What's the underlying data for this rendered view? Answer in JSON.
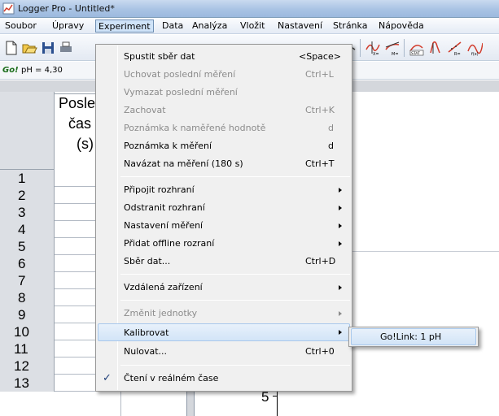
{
  "window": {
    "title": "Logger Pro - Untitled*"
  },
  "menubar": {
    "items": [
      "Soubor",
      "Úpravy",
      "Experiment",
      "Data",
      "Analýza",
      "Vložit",
      "Nastavení",
      "Stránka",
      "Nápověda"
    ],
    "active": "Experiment"
  },
  "sensor": {
    "badge": "Go!",
    "reading": "pH = 4,30"
  },
  "table": {
    "header_line1": "Posle",
    "header_line2": "čas",
    "header_line3": "(s)",
    "rows": [
      "1",
      "2",
      "3",
      "4",
      "5",
      "6",
      "7",
      "8",
      "9",
      "10",
      "11",
      "12",
      "13"
    ]
  },
  "graph": {
    "tick_label": "5"
  },
  "experiment_menu": {
    "items": [
      {
        "label": "Spustit sběr dat",
        "shortcut": "<Space>",
        "enabled": true
      },
      {
        "label": "Uchovat poslední měření",
        "shortcut": "Ctrl+L",
        "enabled": false
      },
      {
        "label": "Vymazat poslední měření",
        "shortcut": "",
        "enabled": false
      },
      {
        "label": "Zachovat",
        "shortcut": "Ctrl+K",
        "enabled": false
      },
      {
        "label": "Poznámka k naměřené hodnotě",
        "shortcut": "d",
        "enabled": false
      },
      {
        "label": "Poznámka k měření",
        "shortcut": "d",
        "enabled": true
      },
      {
        "label": "Navázat na měření (180 s)",
        "shortcut": "Ctrl+T",
        "enabled": true
      },
      {
        "label": "Připojit rozhraní",
        "submenu": true,
        "enabled": true
      },
      {
        "label": "Odstranit rozhraní",
        "submenu": true,
        "enabled": true
      },
      {
        "label": "Nastavení měření",
        "submenu": true,
        "enabled": true
      },
      {
        "label": "Přidat offline rozraní",
        "submenu": true,
        "enabled": true
      },
      {
        "label": "Sběr dat...",
        "shortcut": "Ctrl+D",
        "enabled": true
      },
      {
        "label": "Vzdálená zařízení",
        "submenu": true,
        "enabled": true
      },
      {
        "label": "Změnit jednotky",
        "submenu": true,
        "enabled": false
      },
      {
        "label": "Kalibrovat",
        "submenu": true,
        "enabled": true,
        "highlighted": true
      },
      {
        "label": "Nulovat...",
        "shortcut": "Ctrl+0",
        "enabled": true
      },
      {
        "label": "Čtení v reálném čase",
        "checked": true,
        "enabled": true
      }
    ]
  },
  "calibrate_submenu": {
    "items": [
      "Go!Link: 1 pH"
    ]
  }
}
